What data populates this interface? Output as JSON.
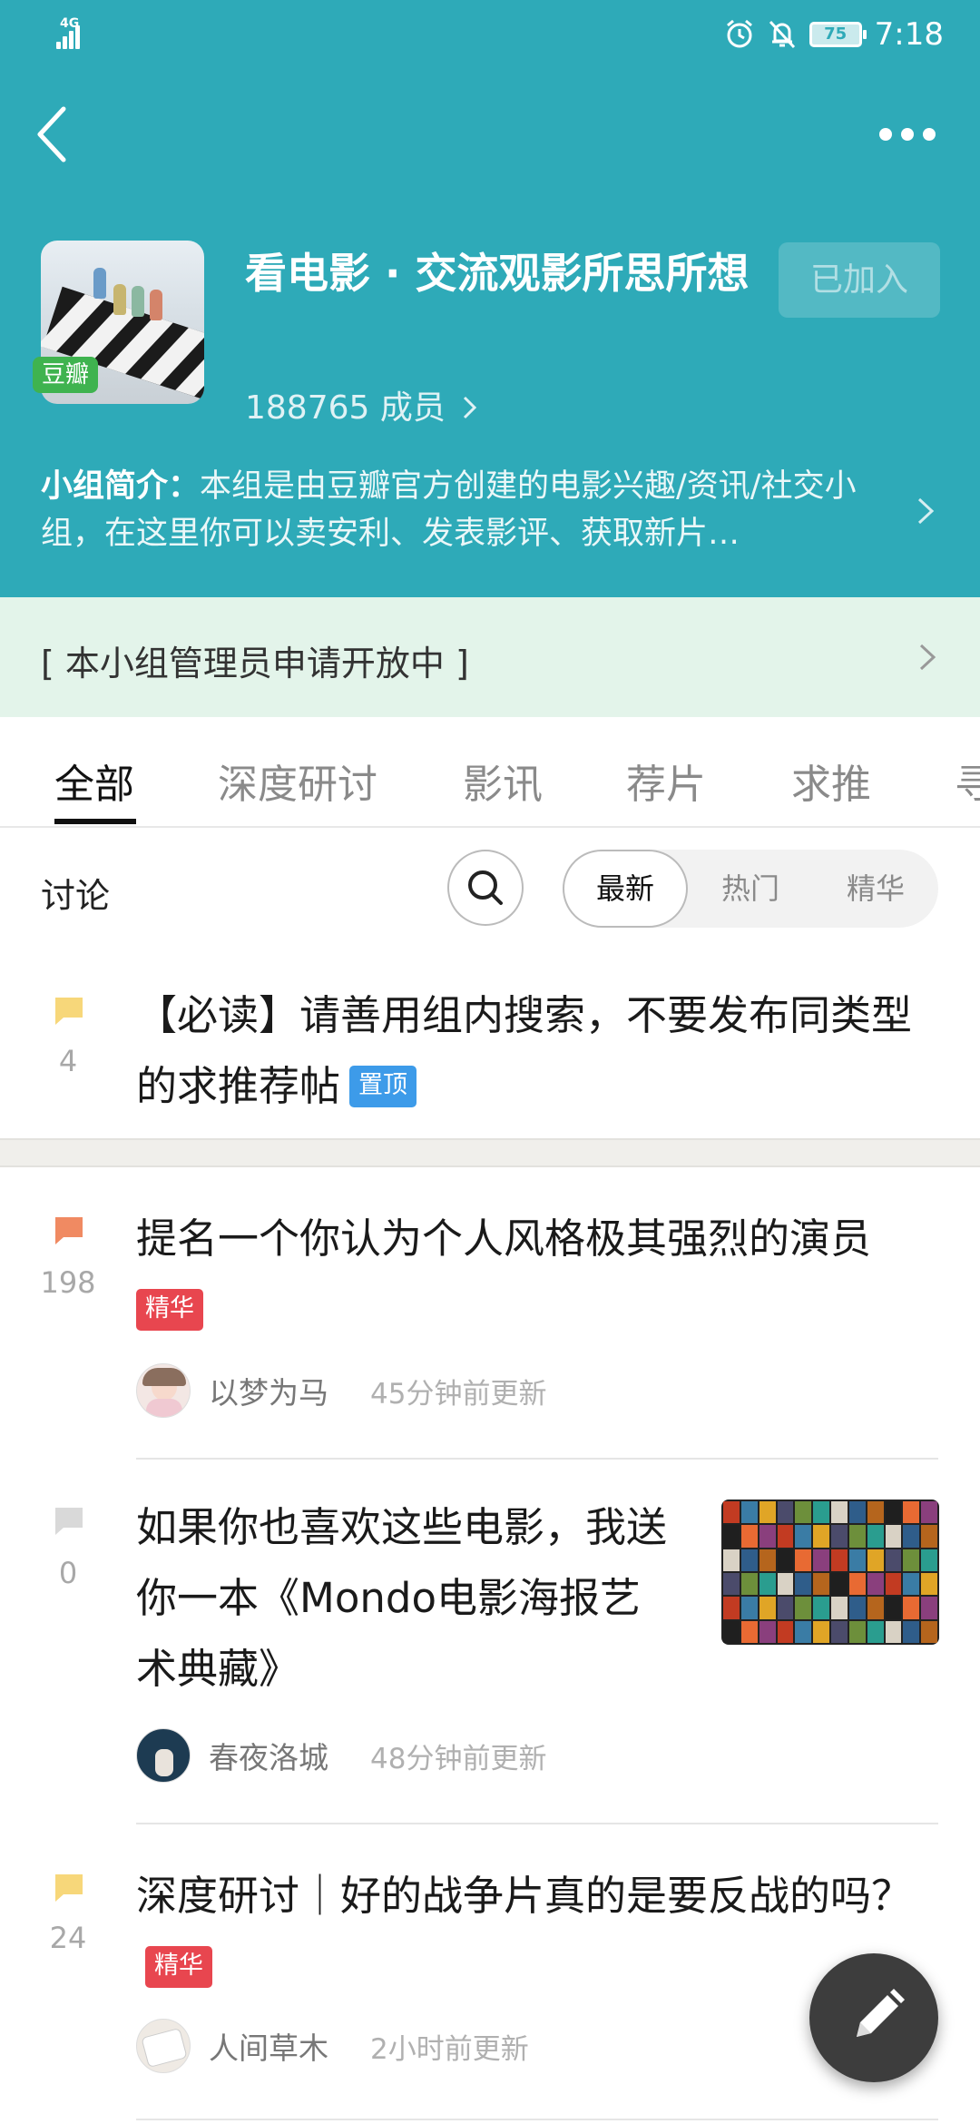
{
  "status_bar": {
    "network": "4G",
    "battery": "75",
    "time": "7:18"
  },
  "group": {
    "badge": "豆瓣",
    "title": "看电影 · 交流观影所思所想",
    "members": "188765 成员",
    "join_state": "已加入",
    "intro_label": "小组简介：",
    "intro_text": "本组是由豆瓣官方创建的电影兴趣/资讯/社交小组，在这里你可以卖安利、发表影评、获取新片…"
  },
  "notice": "[ 本小组管理员申请开放中 ]",
  "tabs": [
    "全部",
    "深度研讨",
    "影讯",
    "荐片",
    "求推",
    "寻"
  ],
  "filter": {
    "label": "讨论",
    "options": [
      "最新",
      "热门",
      "精华"
    ],
    "selected": "最新"
  },
  "posts": [
    {
      "count": "4",
      "title": "【必读】请善用组内搜索，不要发布同类型的求推荐帖",
      "badge": "置顶",
      "icon_color": "#f7d77a"
    },
    {
      "count": "198",
      "title": "提名一个你认为个人风格极其强烈的演员",
      "badge": "精华",
      "author": "以梦为马",
      "time": "45分钟前更新",
      "icon_color": "#f08a62"
    },
    {
      "count": "0",
      "title": "如果你也喜欢这些电影，我送你一本《Mondo电影海报艺术典藏》",
      "author": "春夜洛城",
      "time": "48分钟前更新",
      "icon_color": "#d9d9d9"
    },
    {
      "count": "24",
      "title": "深度研讨｜好的战争片真的是要反战的吗？",
      "badge": "精华",
      "author": "人间草木",
      "time": "2小时前更新",
      "icon_color": "#f7d77a"
    }
  ],
  "icons": {
    "back": "back-arrow-icon",
    "more": "more-dots-icon",
    "search": "search-icon",
    "compose": "pencil-icon"
  },
  "colors": {
    "header": "#2eaab8",
    "notice_bg": "#e3f4ea",
    "essence": "#e8464f",
    "pinned": "#3d9be9"
  }
}
